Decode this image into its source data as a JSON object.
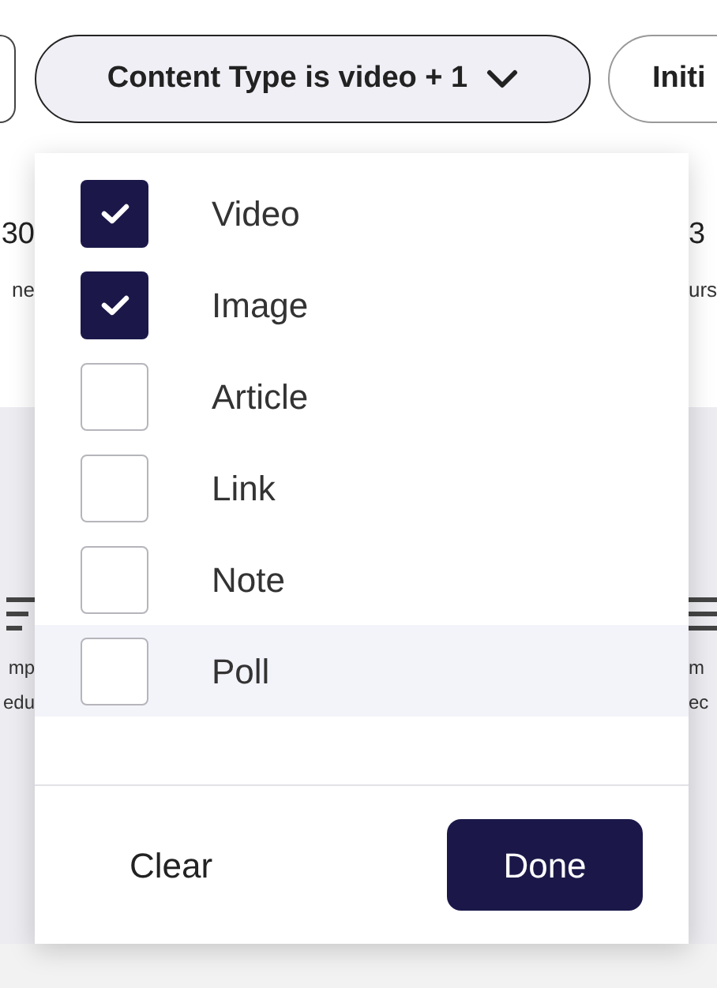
{
  "filter_chips": [
    {
      "label": "Content Type is video + 1",
      "open": true
    },
    {
      "label": "Initi",
      "open": false
    }
  ],
  "background_cards": [
    {
      "value": "30",
      "caption": "ne",
      "footer_lines": [
        "mp",
        "edu"
      ]
    },
    {
      "value": "3",
      "caption": "urs",
      "footer_lines": [
        "m",
        "ec"
      ]
    }
  ],
  "dropdown": {
    "options": [
      {
        "label": "Video",
        "checked": true,
        "hovered": false
      },
      {
        "label": "Image",
        "checked": true,
        "hovered": false
      },
      {
        "label": "Article",
        "checked": false,
        "hovered": false
      },
      {
        "label": "Link",
        "checked": false,
        "hovered": false
      },
      {
        "label": "Note",
        "checked": false,
        "hovered": false
      },
      {
        "label": "Poll",
        "checked": false,
        "hovered": true
      }
    ],
    "buttons": [
      {
        "kind": "text",
        "label": "Clear"
      },
      {
        "kind": "primary",
        "label": "Done"
      }
    ]
  }
}
